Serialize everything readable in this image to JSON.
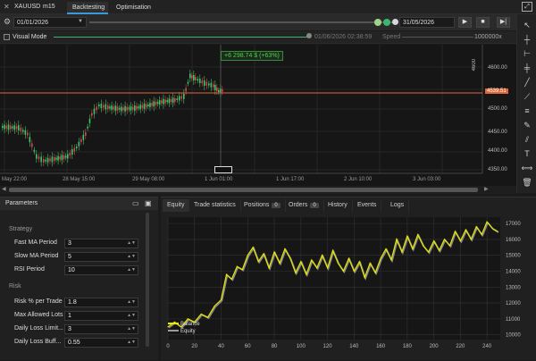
{
  "titlebar": {
    "symbol": "XAUUSD",
    "timeframe": "m15",
    "tabs": [
      "Backtesting",
      "Optimisation"
    ]
  },
  "toolbar": {
    "start_date": "01/01/2026",
    "end_date": "31/05/2026"
  },
  "visual_mode": {
    "label": "Visual Mode",
    "timestamp": "01/06/2026 02:38:59",
    "speed_label": "Speed",
    "speed_value": "1000000x"
  },
  "chart": {
    "pnl_badge": "+6 298.74 $ (+63%)",
    "price_ticks": [
      "4600.00",
      "4500.00",
      "4450.00",
      "4400.00",
      "4350.00"
    ],
    "current_price": "4539.51",
    "top_label": "4600",
    "x_ticks": [
      "May 22:00",
      "28 May 15:00",
      "29 May 08:00",
      "1 Jun 01:00",
      "1 Jun 17:00",
      "2 Jun 10:00",
      "3 Jun 03:00"
    ],
    "last_price_color": "#e0663a"
  },
  "params": {
    "title": "Parameters",
    "groups": [
      {
        "name": "Strategy",
        "items": [
          {
            "label": "Fast MA Period",
            "value": "3"
          },
          {
            "label": "Slow MA Period",
            "value": "5"
          },
          {
            "label": "RSI Period",
            "value": "10"
          }
        ]
      },
      {
        "name": "Risk",
        "items": [
          {
            "label": "Risk % per Trade",
            "value": "1.8"
          },
          {
            "label": "Max Allowed Lots",
            "value": "1"
          },
          {
            "label": "Daily Loss Limit...",
            "value": "3"
          },
          {
            "label": "Daily Loss Buff...",
            "value": "0.55"
          }
        ]
      }
    ]
  },
  "results": {
    "tabs": [
      {
        "label": "Equity",
        "badge": ""
      },
      {
        "label": "Trade statistics",
        "badge": ""
      },
      {
        "label": "Positions",
        "badge": "0"
      },
      {
        "label": "Orders",
        "badge": "0"
      },
      {
        "label": "History",
        "badge": ""
      },
      {
        "label": "Events",
        "badge": ""
      },
      {
        "label": "Logs",
        "badge": ""
      }
    ],
    "legend": {
      "balance": "Balance",
      "equity": "Equity"
    },
    "y_ticks": [
      "17000",
      "16000",
      "15000",
      "14000",
      "13000",
      "12000",
      "11000",
      "10000"
    ],
    "x_ticks": [
      "0",
      "20",
      "40",
      "60",
      "80",
      "100",
      "120",
      "140",
      "160",
      "180",
      "200",
      "220",
      "240"
    ]
  },
  "chart_data": {
    "type": "line",
    "xlim": [
      0,
      250
    ],
    "ylim": [
      9700,
      17400
    ],
    "series": [
      {
        "name": "Balance",
        "color": "#e8e800",
        "x": [
          0,
          5,
          10,
          15,
          20,
          25,
          30,
          35,
          40,
          44,
          48,
          52,
          56,
          60,
          64,
          68,
          72,
          76,
          80,
          84,
          88,
          92,
          96,
          100,
          104,
          108,
          112,
          116,
          120,
          124,
          128,
          132,
          136,
          140,
          144,
          148,
          152,
          156,
          160,
          164,
          168,
          172,
          176,
          180,
          184,
          188,
          192,
          196,
          200,
          204,
          208,
          212,
          216,
          220,
          224,
          228,
          232,
          236,
          240,
          244,
          248
        ],
        "y": [
          10500,
          10800,
          10500,
          11000,
          10800,
          11300,
          11100,
          11800,
          12200,
          13800,
          13500,
          14300,
          14100,
          15000,
          15500,
          14600,
          15100,
          14200,
          15200,
          14500,
          15400,
          14800,
          13900,
          14600,
          13800,
          14700,
          14200,
          15000,
          14200,
          15300,
          14500,
          14000,
          14800,
          14000,
          14600,
          13600,
          14500,
          13900,
          14800,
          15400,
          14700,
          16000,
          15200,
          16200,
          15400,
          16300,
          15600,
          15200,
          15900,
          15300,
          16000,
          15600,
          16500,
          15900,
          16600,
          16000,
          16800,
          16300,
          17100,
          16700,
          16500
        ]
      }
    ]
  }
}
